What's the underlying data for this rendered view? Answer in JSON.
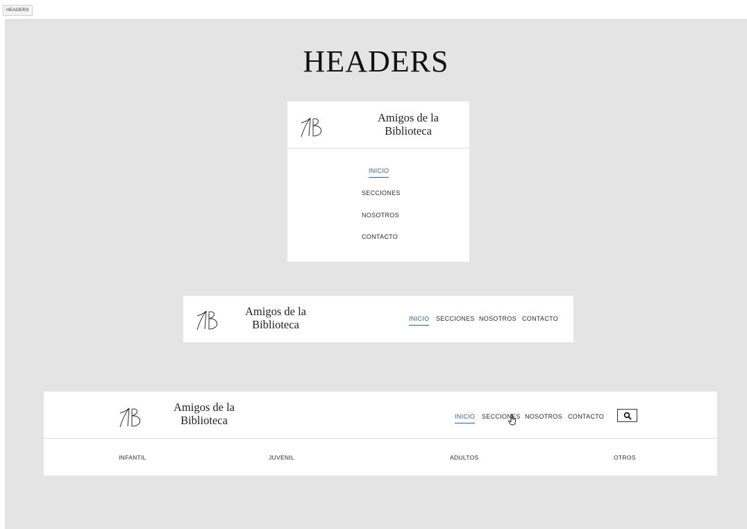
{
  "tab": {
    "label": "HEADERS"
  },
  "page": {
    "title": "HEADERS"
  },
  "brand": {
    "line1": "Amigos de la",
    "line2": "Biblioteca",
    "logo_icon": "ab-monogram-icon"
  },
  "nav": {
    "items": [
      "INICIO",
      "SECCIONES",
      "NOSOTROS",
      "CONTACTO"
    ],
    "active": "INICIO"
  },
  "search": {
    "icon": "search-icon"
  },
  "categories": [
    "INFANTIL",
    "JUVENIL",
    "ADULTOS",
    "OTROS"
  ],
  "colors": {
    "background": "#e4e4e4",
    "card": "#ffffff",
    "accent": "#3a5f86",
    "text": "#1a1a1a"
  }
}
